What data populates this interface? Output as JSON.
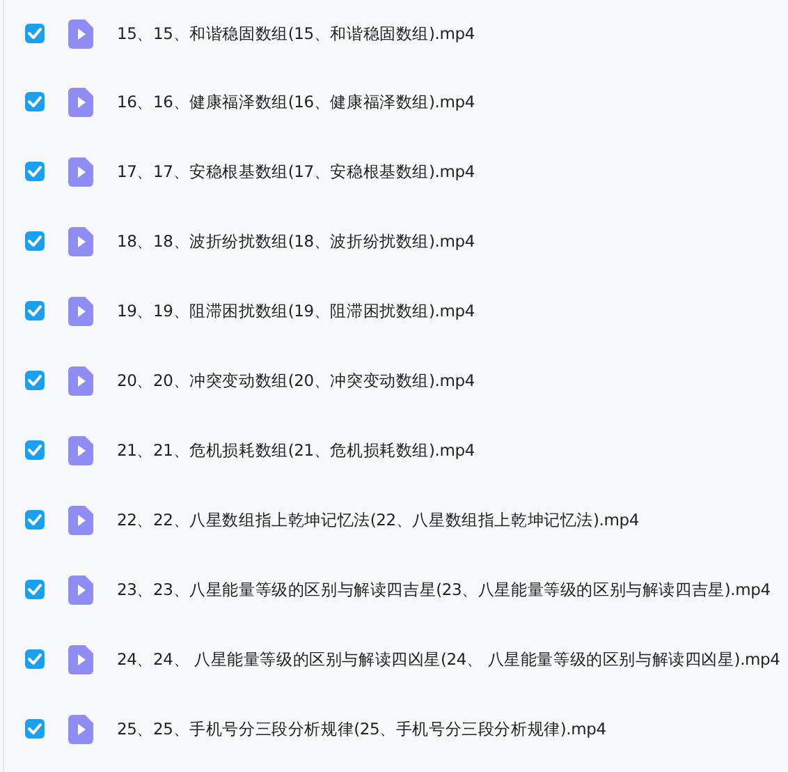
{
  "files": [
    {
      "name": "15、15、和谐稳固数组(15、和谐稳固数组).mp4",
      "checked": true
    },
    {
      "name": "16、16、健康福泽数组(16、健康福泽数组).mp4",
      "checked": true
    },
    {
      "name": "17、17、安稳根基数组(17、安稳根基数组).mp4",
      "checked": true
    },
    {
      "name": "18、18、波折纷扰数组(18、波折纷扰数组).mp4",
      "checked": true
    },
    {
      "name": "19、19、阻滞困扰数组(19、阻滞困扰数组).mp4",
      "checked": true
    },
    {
      "name": "20、20、冲突变动数组(20、冲突变动数组).mp4",
      "checked": true
    },
    {
      "name": "21、21、危机损耗数组(21、危机损耗数组).mp4",
      "checked": true
    },
    {
      "name": "22、22、八星数组指上乾坤记忆法(22、八星数组指上乾坤记忆法).mp4",
      "checked": true
    },
    {
      "name": "23、23、八星能量等级的区别与解读四吉星(23、八星能量等级的区别与解读四吉星).mp4",
      "checked": true
    },
    {
      "name": "24、24、 八星能量等级的区别与解读四凶星(24、 八星能量等级的区别与解读四凶星).mp4",
      "checked": true
    },
    {
      "name": "25、25、手机号分三段分析规律(25、手机号分三段分析规律).mp4",
      "checked": true
    }
  ]
}
